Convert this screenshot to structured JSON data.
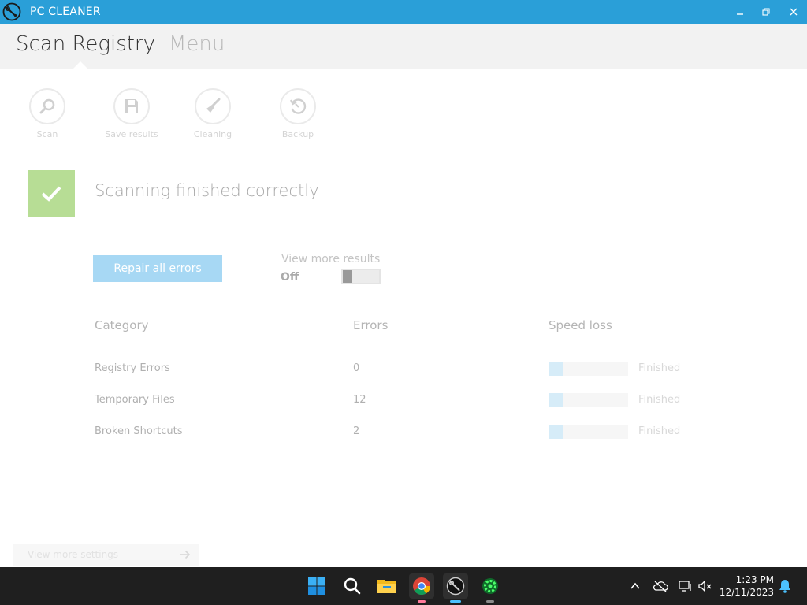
{
  "window": {
    "title": "PC CLEANER"
  },
  "tabs": [
    {
      "label": "Scan Registry"
    },
    {
      "label": "Menu"
    }
  ],
  "toolbar": [
    {
      "label": "Scan",
      "icon": "search-icon"
    },
    {
      "label": "Save results",
      "icon": "save-icon"
    },
    {
      "label": "Cleaning",
      "icon": "brush-icon"
    },
    {
      "label": "Backup",
      "icon": "restore-icon"
    }
  ],
  "status": {
    "message": "Scanning finished correctly",
    "icon": "check-icon",
    "color": "#b7dd95"
  },
  "actions": {
    "repair_label": "Repair all errors",
    "more_results_label": "View more results",
    "toggle_state": "Off"
  },
  "table": {
    "headers": [
      "Category",
      "Errors",
      "Speed loss"
    ],
    "rows": [
      {
        "category": "Registry Errors",
        "errors": "0",
        "status": "Finished"
      },
      {
        "category": "Temporary Files",
        "errors": "12",
        "status": "Finished"
      },
      {
        "category": "Broken Shortcuts",
        "errors": "2",
        "status": "Finished"
      }
    ]
  },
  "settings": {
    "label": "View more settings"
  },
  "taskbar": {
    "time": "1:23 PM",
    "date": "12/11/2023"
  },
  "colors": {
    "titlebar": "#2a9fd8",
    "accent": "#a7d8f4",
    "taskbar": "#1f1f1f"
  }
}
